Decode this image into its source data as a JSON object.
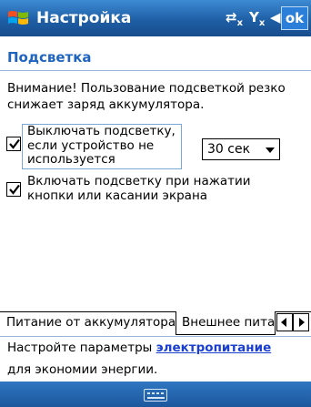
{
  "title_bar": {
    "title": "Настройка",
    "ok_label": "ok",
    "colors": {
      "bar": "#1f5fa6",
      "accent": "#2b7fd8"
    },
    "status_icons": [
      "connectivity-icon",
      "signal-off-icon",
      "volume-icon"
    ]
  },
  "page": {
    "header": "Подсветка",
    "warning": "Внимание! Пользование подсветкой резко снижает заряд аккумулятора."
  },
  "options": {
    "opt1": {
      "checked": true,
      "label": "Выключать подсветку, если устройство не используется",
      "dropdown_value": "30 сек"
    },
    "opt2": {
      "checked": true,
      "label": "Включать подсветку при нажатии кнопки или касании экрана"
    }
  },
  "tabs": [
    {
      "label": "Питание от аккумулятора",
      "active": true
    },
    {
      "label": "Внешнее питание",
      "active": false
    }
  ],
  "info": {
    "prefix": "Настройте параметры ",
    "link": "электропитание",
    "line2": "для экономии энергии."
  },
  "bottom_bar": {
    "icon": "keyboard-icon"
  }
}
